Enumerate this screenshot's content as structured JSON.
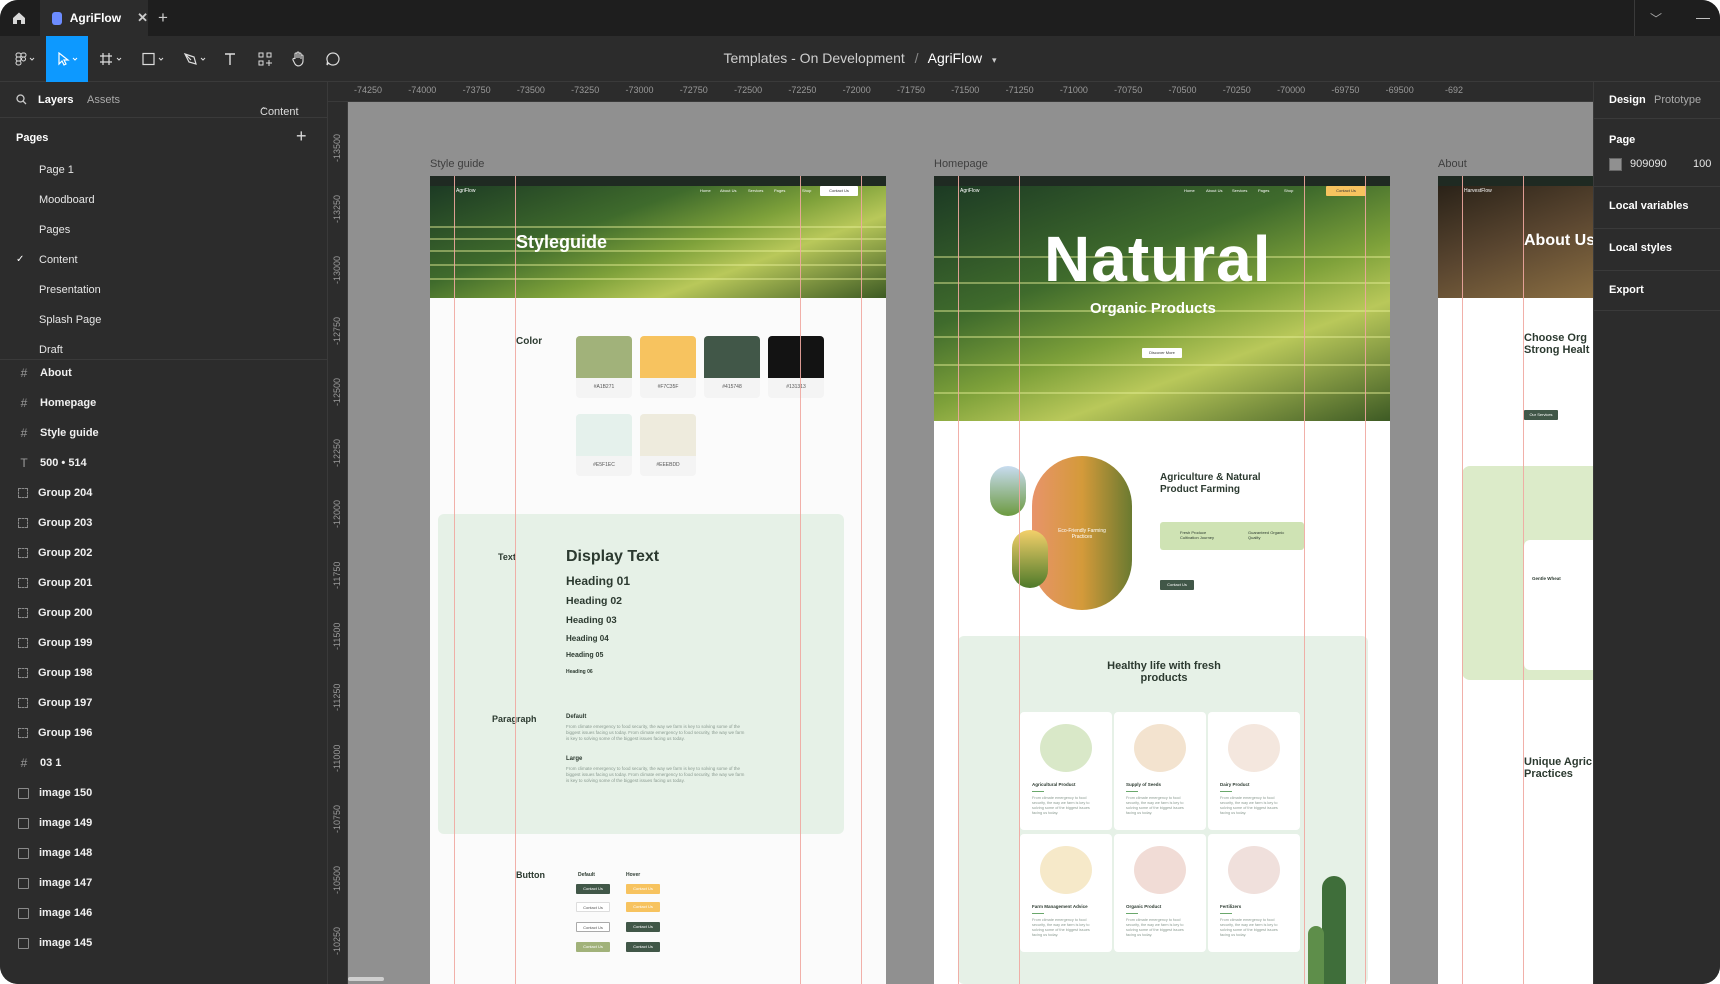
{
  "titlebar": {
    "file_tab": "AgriFlow"
  },
  "toolbar": {
    "breadcrumb_parent": "Templates - On Development",
    "breadcrumb_sep": "/",
    "breadcrumb_file": "AgriFlow"
  },
  "left_panel": {
    "tabs": {
      "layers": "Layers",
      "assets": "Assets",
      "page_switch": "Content"
    },
    "pages_heading": "Pages",
    "pages": [
      "Page 1",
      "Moodboard",
      "Pages",
      "Content",
      "Presentation",
      "Splash Page",
      "Draft"
    ],
    "current_page": "Content",
    "layers": [
      {
        "icon": "frame",
        "name": "About"
      },
      {
        "icon": "frame",
        "name": "Homepage"
      },
      {
        "icon": "frame",
        "name": "Style guide"
      },
      {
        "icon": "text",
        "name": "500 • 514"
      },
      {
        "icon": "group",
        "name": "Group 204"
      },
      {
        "icon": "group",
        "name": "Group 203"
      },
      {
        "icon": "group",
        "name": "Group 202"
      },
      {
        "icon": "group",
        "name": "Group 201"
      },
      {
        "icon": "group",
        "name": "Group 200"
      },
      {
        "icon": "group",
        "name": "Group 199"
      },
      {
        "icon": "group",
        "name": "Group 198"
      },
      {
        "icon": "group",
        "name": "Group 197"
      },
      {
        "icon": "group",
        "name": "Group 196"
      },
      {
        "icon": "frame",
        "name": "03 1"
      },
      {
        "icon": "image",
        "name": "image 150"
      },
      {
        "icon": "image",
        "name": "image 149"
      },
      {
        "icon": "image",
        "name": "image 148"
      },
      {
        "icon": "image",
        "name": "image 147"
      },
      {
        "icon": "image",
        "name": "image 146"
      },
      {
        "icon": "image",
        "name": "image 145"
      }
    ]
  },
  "right_panel": {
    "tabs": {
      "design": "Design",
      "prototype": "Prototype"
    },
    "page_heading": "Page",
    "page_color": "909090",
    "page_opacity": "100",
    "local_variables": "Local variables",
    "local_styles": "Local styles",
    "export": "Export"
  },
  "ruler": {
    "top": [
      "-74250",
      "-74000",
      "-73750",
      "-73500",
      "-73250",
      "-73000",
      "-72750",
      "-72500",
      "-72250",
      "-72000",
      "-71750",
      "-71500",
      "-71250",
      "-71000",
      "-70750",
      "-70500",
      "-70250",
      "-70000",
      "-69750",
      "-69500",
      "-692"
    ],
    "left": [
      "-13500",
      "-13250",
      "-13000",
      "-12750",
      "-12500",
      "-12250",
      "-12000",
      "-11750",
      "-11500",
      "-11250",
      "-11000",
      "-10750",
      "-10500",
      "-10250"
    ]
  },
  "canvas": {
    "frame_labels": {
      "style_guide": "Style guide",
      "homepage": "Homepage",
      "about": "About"
    },
    "style_guide": {
      "logo": "AgriFlow",
      "nav": [
        "Home",
        "About Us",
        "Services",
        "Pages",
        "Shop"
      ],
      "nav_button": "Contact Us",
      "hero_title": "Styleguide",
      "color_label": "Color",
      "colors": [
        {
          "hex": "#A1B27A",
          "label": "#A1B271"
        },
        {
          "hex": "#F7C35F",
          "label": "#F7C35F"
        },
        {
          "hex": "#415748",
          "label": "#415748"
        },
        {
          "hex": "#131313",
          "label": "#131313"
        },
        {
          "hex": "#E5F1EC",
          "label": "#E5F1EC"
        },
        {
          "hex": "#EEEBDD",
          "label": "#EEEBDD"
        }
      ],
      "text_label": "Text",
      "display": "Display Text",
      "headings": [
        "Heading 01",
        "Heading 02",
        "Heading 03",
        "Heading 04",
        "Heading 05",
        "Heading 06"
      ],
      "paragraph_label": "Paragraph",
      "para_default": "Default",
      "para_large": "Large",
      "para_body": "From climate emergency to food security, the way we farm is key to solving some of the biggest issues facing us today. From climate emergency to food security, the way we farm is key to solving some of the biggest issues facing us today.",
      "button_label": "Button",
      "btn_default": "Default",
      "btn_hover": "Hover",
      "btn_text": "Contact Us"
    },
    "homepage": {
      "logo": "AgriFlow",
      "nav": [
        "Home",
        "About Us",
        "Services",
        "Pages",
        "Shop"
      ],
      "nav_button": "Contact Us",
      "hero_big": "Natural",
      "hero_sub": "Organic Products",
      "hero_button": "Discover More",
      "badge": "Eco-Friendly Farming Practices",
      "section_title": "Agriculture & Natural Product Farming",
      "feature_1": "Fresh Produce Cultivation Journey",
      "feature_2": "Guaranteed Organic Quality",
      "contact_button": "Contact Us",
      "healthy_title": "Healthy life with fresh products",
      "cards": [
        {
          "title": "Agricultural Product",
          "color": "#d9e8c8"
        },
        {
          "title": "Supply of Seeds",
          "color": "#f3e3cf"
        },
        {
          "title": "Dairy Product",
          "color": "#f4e7de"
        },
        {
          "title": "Farm Management Advice",
          "color": "#f6e9c9"
        },
        {
          "title": "Organic Product",
          "color": "#f1dcd6"
        },
        {
          "title": "Fertilizers",
          "color": "#f0e0dc"
        }
      ],
      "card_body": "From climate emergency to food security, the way we farm is key to solving some of the biggest issues facing us today."
    },
    "about": {
      "logo": "HarvestFlow",
      "hero_title": "About Us",
      "heading": "Choose Org Strong Healt",
      "button": "Our Services",
      "card_title": "Gentle Wheat",
      "heading_2": "Unique Agric Practices"
    }
  }
}
